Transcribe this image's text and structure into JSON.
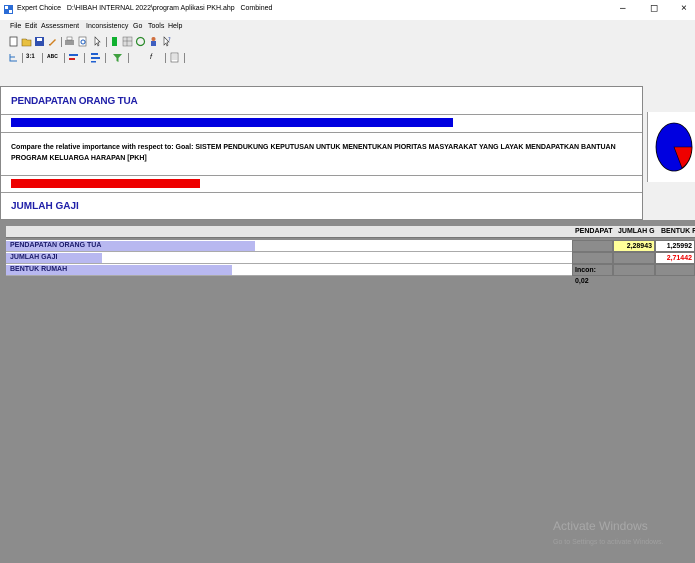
{
  "window": {
    "app_name": "Expert Choice",
    "file_path": "D:\\HIBAH INTERNAL 2022\\program Aplikasi PKH.ahp",
    "mode": "Combined",
    "minimize": "–",
    "maximize": "◻",
    "close": "×"
  },
  "menu": {
    "items": [
      "File",
      "Edit",
      "Assessment",
      "Inconsistency",
      "Go",
      "Tools",
      "Help"
    ]
  },
  "toolbar2": {
    "labels": [
      "3:1",
      "ABC"
    ]
  },
  "node": {
    "title": "PENDAPATAN ORANG TUA",
    "priority_fraction": 0.69
  },
  "compare": {
    "text": "Compare the relative importance with respect to: Goal: SISTEM PENDUKUNG KEPUTUSAN UNTUK MENENTUKAN PIORITAS MASYARAKAT YANG LAYAK MENDAPATKAN BANTUAN PROGRAM KELUARGA HARAPAN [PKH]",
    "weight_fraction": 0.31
  },
  "alternative": {
    "title": "JUMLAH GAJI"
  },
  "pie": {
    "blue_color": "#0000e0",
    "red_color": "#ee0000"
  },
  "matrix": {
    "columns": [
      "PENDAPAT",
      "JUMLAH G",
      "BENTUK R"
    ],
    "rows": [
      {
        "label": "PENDAPATAN ORANG TUA",
        "bar_fraction": 0.44
      },
      {
        "label": "JUMLAH GAJI",
        "bar_fraction": 0.17
      },
      {
        "label": "BENTUK RUMAH",
        "bar_fraction": 0.4
      }
    ],
    "cells": {
      "r1c2": "2,28943",
      "r1c3": "1,25992",
      "r2c3": "2,71442",
      "incons": "Incon: 0,02"
    }
  },
  "watermark": {
    "line1": "Activate Windows",
    "line2": "Go to Settings to activate Windows."
  }
}
